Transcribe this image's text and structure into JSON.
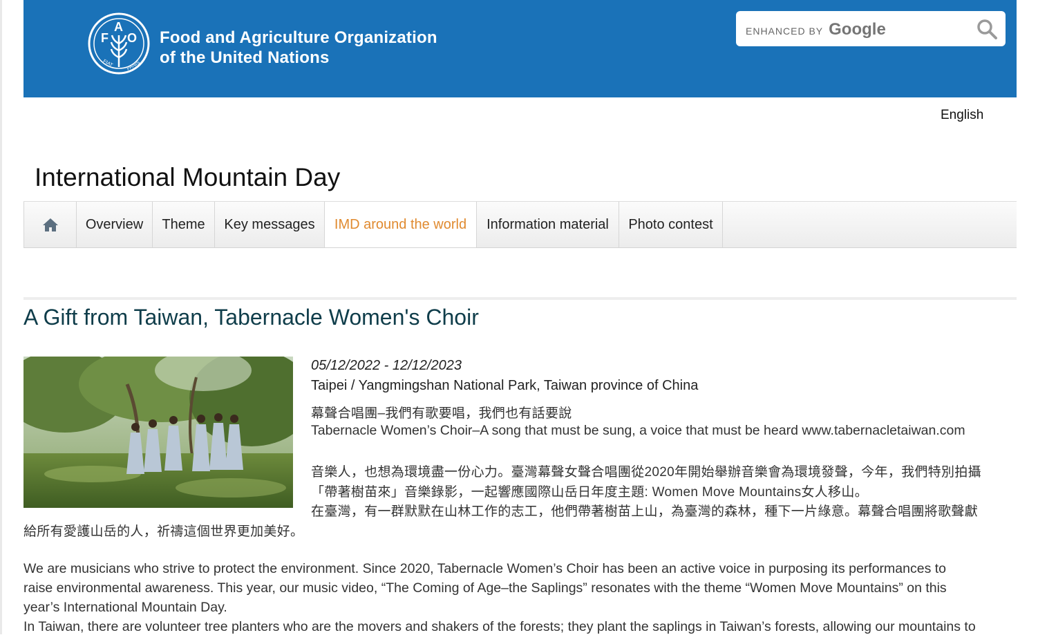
{
  "header": {
    "org_line1": "Food and Agriculture Organization",
    "org_line2": "of the United Nations",
    "logo_icon": "fao-logo-icon",
    "logo_letters": [
      "F",
      "A",
      "O"
    ],
    "logo_motto": "FIAT PANIS",
    "search": {
      "enhanced_by": "ENHANCED BY",
      "google": "Google",
      "icon": "search-icon"
    },
    "colors": {
      "brand": "#1a72b8",
      "accent": "#e08a2f"
    }
  },
  "language": "English",
  "page_title": "International Mountain Day",
  "nav": {
    "home_icon": "home-icon",
    "items": [
      {
        "label": "Overview"
      },
      {
        "label": "Theme"
      },
      {
        "label": "Key messages"
      },
      {
        "label": "IMD around the world",
        "active": true
      },
      {
        "label": "Information material"
      },
      {
        "label": "Photo contest"
      }
    ]
  },
  "article": {
    "title": "A Gift from Taiwan, Tabernacle Women's Choir",
    "date": "05/12/2022 - 12/12/2023",
    "location": "Taipei / Yangmingshan National Park, Taiwan province of China",
    "zh_line1": "幕聲合唱團–我們有歌要唱，我們也有話要說",
    "en_line1": "Tabernacle Women’s Choir–A song that must be sung, a voice that must be heard www.tabernacletaiwan.com",
    "zh_p1_l1": "音樂人，也想為環境盡一份心力。臺灣幕聲女聲合唱團從2020年開始舉辦音樂會為環境發聲，今年，我們特別拍攝",
    "zh_p1_l2": "「帶著樹苗來」音樂錄影，一起響應國際山岳日年度主題: Women Move Mountains女人移山。",
    "zh_p1_l3": "在臺灣，有一群默默在山林工作的志工，他們帶著樹苗上山，為臺灣的森林，種下一片綠意。幕聲合唱團將歌聲獻",
    "zh_p1_l4": "給所有愛護山岳的人，祈禱這個世界更加美好。",
    "en_p1_l1": "We are musicians who strive to protect the environment. Since 2020, Tabernacle Women’s Choir has been an active voice in purposing its performances to",
    "en_p1_l2": "raise environmental awareness. This year, our music video, “The Coming of Age–the Saplings” resonates with the theme “Women Move Mountains” on this",
    "en_p1_l3": "year’s International Mountain Day.",
    "en_p2_l1": "In Taiwan, there are volunteer tree planters who are the movers and shakers of the forests; they plant the saplings in Taiwan’s forests, allowing our mountains to",
    "photo_icon": "choir-photo"
  }
}
